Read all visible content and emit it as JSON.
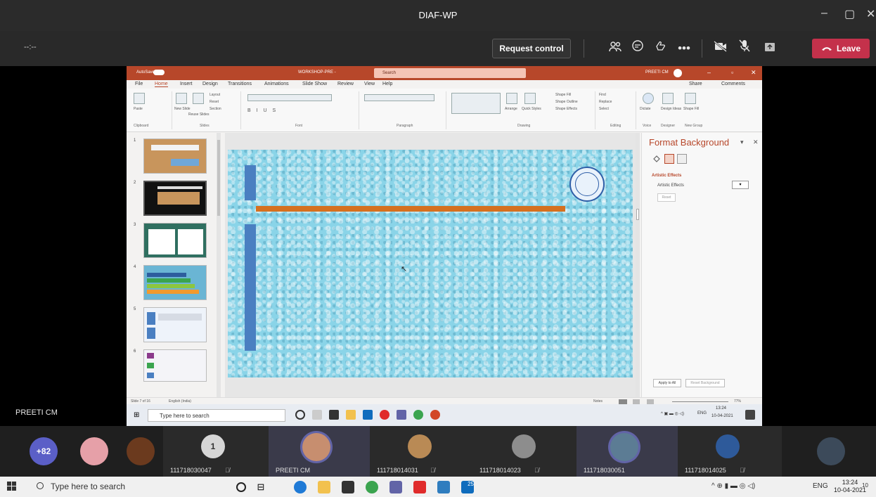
{
  "window": {
    "title": "DIAF-WP",
    "minimize": "–",
    "maximize": "▢",
    "close": "✕"
  },
  "meeting": {
    "timer": "--:--",
    "request_control": "Request control",
    "leave": "Leave",
    "presenter": "PREETI CM"
  },
  "powerpoint": {
    "autosave": "AutoSave",
    "doc_title": "WORKSHOP-PRE -",
    "search": "Search",
    "user": "PREETI CM",
    "menu": [
      "File",
      "Home",
      "Insert",
      "Design",
      "Transitions",
      "Animations",
      "Slide Show",
      "Review",
      "View",
      "Help"
    ],
    "share": "Share",
    "comments": "Comments",
    "groups": [
      "Clipboard",
      "Slides",
      "Font",
      "Paragraph",
      "Drawing",
      "Editing",
      "Voice",
      "Designer",
      "New Group"
    ],
    "ribbon": {
      "paste": "Paste",
      "new_slide": "New Slide",
      "reuse_slides": "Reuse Slides",
      "layout": "Layout",
      "reset": "Reset",
      "section": "Section",
      "arrange": "Arrange",
      "quick_styles": "Quick Styles",
      "shape_fill": "Shape Fill",
      "shape_outline": "Shape Outline",
      "shape_effects": "Shape Effects",
      "find": "Find",
      "replace": "Replace",
      "select": "Select",
      "dictate": "Dictate",
      "design_ideas": "Design Ideas",
      "shape_fill2": "Shape Fill"
    },
    "thumbnails": [
      "1",
      "2",
      "3",
      "4",
      "5",
      "6"
    ],
    "format_pane": {
      "title": "Format Background",
      "section": "Artistic Effects",
      "label": "Artistic Effects",
      "reset": "Reset",
      "apply_all": "Apply to All",
      "reset_bg": "Reset Background"
    },
    "status": {
      "slide": "Slide 7 of 16",
      "lang": "English (India)",
      "notes": "Notes",
      "zoom": "77%"
    }
  },
  "inner_taskbar": {
    "search": "Type here to search",
    "lang": "ENG",
    "time": "13:24",
    "date": "10-04-2021"
  },
  "participants": {
    "overflow": "+82",
    "count_badge": "1",
    "tiles": [
      "111718030047",
      "PREETI CM",
      "111718014031",
      "111718014023",
      "111718030051",
      "111718014025"
    ]
  },
  "taskbar": {
    "search": "Type here to search",
    "lang": "ENG",
    "time": "13:24",
    "date": "10-04-2021",
    "notif": "10",
    "badge": "25"
  },
  "colors": {
    "brand_ppt": "#b7472a",
    "leave": "#c4314b",
    "teams_accent": "#6264a7"
  }
}
